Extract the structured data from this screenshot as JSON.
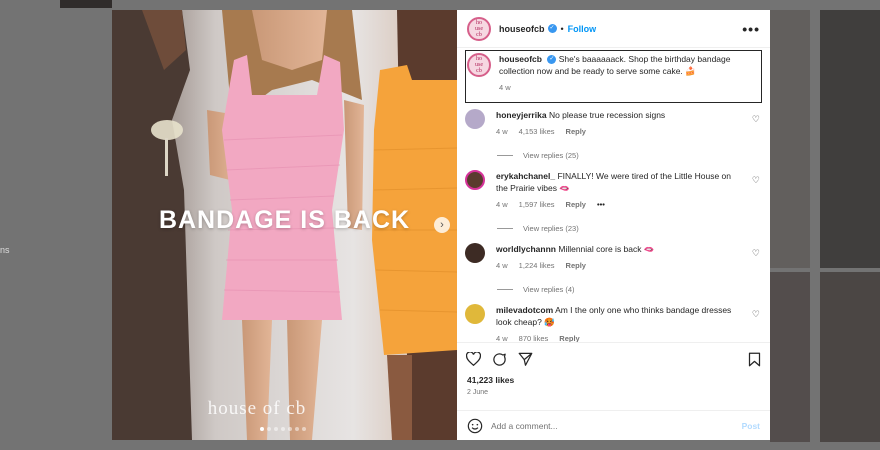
{
  "background": {
    "side_text": "ns"
  },
  "post": {
    "media": {
      "headline": "BANDAGE IS BACK",
      "brand_mark": "house of cb",
      "slide_count": 7,
      "active_slide": 1
    },
    "header": {
      "username": "houseofcb",
      "separator": "•",
      "follow_label": "Follow",
      "more_label": "•••"
    },
    "caption": {
      "username": "houseofcb",
      "text": "She's baaaaaack. Shop the birthday bandage collection now and be ready to serve some cake. 🍰",
      "time": "4 w"
    },
    "comments": [
      {
        "username": "honeyjerrika",
        "text": "No please true recession signs",
        "time": "4 w",
        "likes": "4,153 likes",
        "reply": "Reply",
        "view_replies": "View replies (25)",
        "avatar_color": "#b5a9c9"
      },
      {
        "username": "erykahchanel_",
        "text": "FINALLY! We were tired of the Little House on the Prairie vibes 🫦",
        "time": "4 w",
        "likes": "1,597 likes",
        "reply": "Reply",
        "more": "•••",
        "view_replies": "View replies (23)",
        "avatar_color": "#5a3b2e"
      },
      {
        "username": "worldlychannn",
        "text": "Millennial core is back 🫦",
        "time": "4 w",
        "likes": "1,224 likes",
        "reply": "Reply",
        "view_replies": "View replies (4)",
        "avatar_color": "#3d2b24"
      },
      {
        "username": "milevadotcom",
        "text": "Am I the only one who thinks bandage dresses look cheap? 🥵",
        "time": "4 w",
        "likes": "870 likes",
        "reply": "Reply",
        "avatar_color": "#e0b83a"
      }
    ],
    "likes_count": "41,223 likes",
    "date": "2 June",
    "add_comment": {
      "placeholder": "Add a comment...",
      "post_label": "Post"
    }
  },
  "colors": {
    "accent": "#0095f6",
    "verified": "#3897f0",
    "post_disabled": "#b3dbff"
  }
}
